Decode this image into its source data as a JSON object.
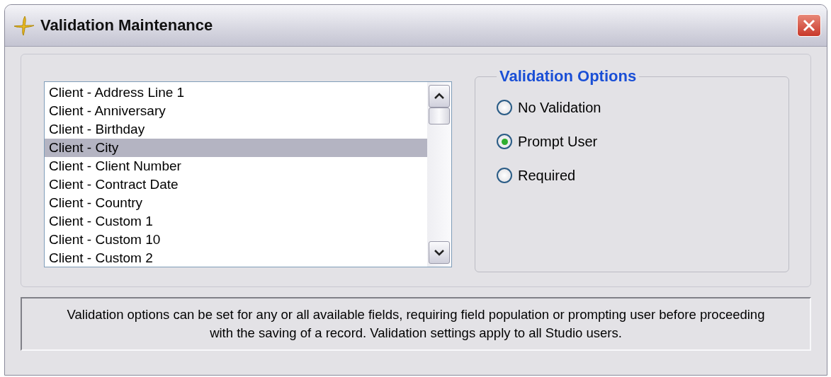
{
  "window": {
    "title": "Validation Maintenance"
  },
  "fields": [
    {
      "label": "Client - Address Line 1",
      "selected": false
    },
    {
      "label": "Client - Anniversary",
      "selected": false
    },
    {
      "label": "Client - Birthday",
      "selected": false
    },
    {
      "label": "Client - City",
      "selected": true
    },
    {
      "label": "Client - Client Number",
      "selected": false
    },
    {
      "label": "Client - Contract Date",
      "selected": false
    },
    {
      "label": "Client - Country",
      "selected": false
    },
    {
      "label": "Client - Custom 1",
      "selected": false
    },
    {
      "label": "Client - Custom 10",
      "selected": false
    },
    {
      "label": "Client - Custom 2",
      "selected": false
    }
  ],
  "validation_options": {
    "title": "Validation Options",
    "options": [
      {
        "label": "No Validation",
        "selected": false
      },
      {
        "label": "Prompt User",
        "selected": true
      },
      {
        "label": "Required",
        "selected": false
      }
    ]
  },
  "info": "Validation options can be set for any or all available fields, requiring field population or prompting user before proceeding with the saving of a record.  Validation settings apply to all Studio users."
}
